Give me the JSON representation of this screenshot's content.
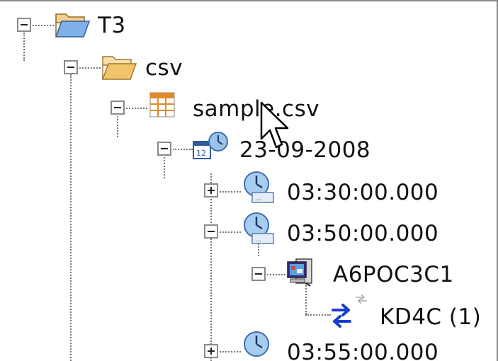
{
  "tree": {
    "nodes": [
      {
        "id": "t3",
        "label": "T3",
        "state": "expanded",
        "icon": "folder-open-icon"
      },
      {
        "id": "csv",
        "label": "csv",
        "state": "expanded",
        "icon": "folder-open-icon"
      },
      {
        "id": "sample",
        "label": "sample.csv",
        "state": "expanded",
        "icon": "csv-table-icon"
      },
      {
        "id": "date",
        "label": "23-09-2008",
        "state": "expanded",
        "icon": "calendar-clock-icon"
      },
      {
        "id": "t0330",
        "label": "03:30:00.000",
        "state": "collapsed",
        "icon": "clock-icon"
      },
      {
        "id": "t0350",
        "label": "03:50:00.000",
        "state": "expanded",
        "icon": "clock-icon"
      },
      {
        "id": "device",
        "label": "A6POC3C1",
        "state": "expanded",
        "icon": "computer-icon"
      },
      {
        "id": "kd4c",
        "label": "KD4C (1)",
        "state": "leaf",
        "icon": "transfer-arrows-icon"
      },
      {
        "id": "t0355",
        "label": "03:55:00.000",
        "state": "collapsed",
        "icon": "clock-icon"
      }
    ]
  },
  "colors": {
    "folder": "#f2c46b",
    "clock_face": "#7fb3e0",
    "arrows": "#1a3fcc",
    "grid_orange": "#e08a2a",
    "text": "#111111"
  }
}
